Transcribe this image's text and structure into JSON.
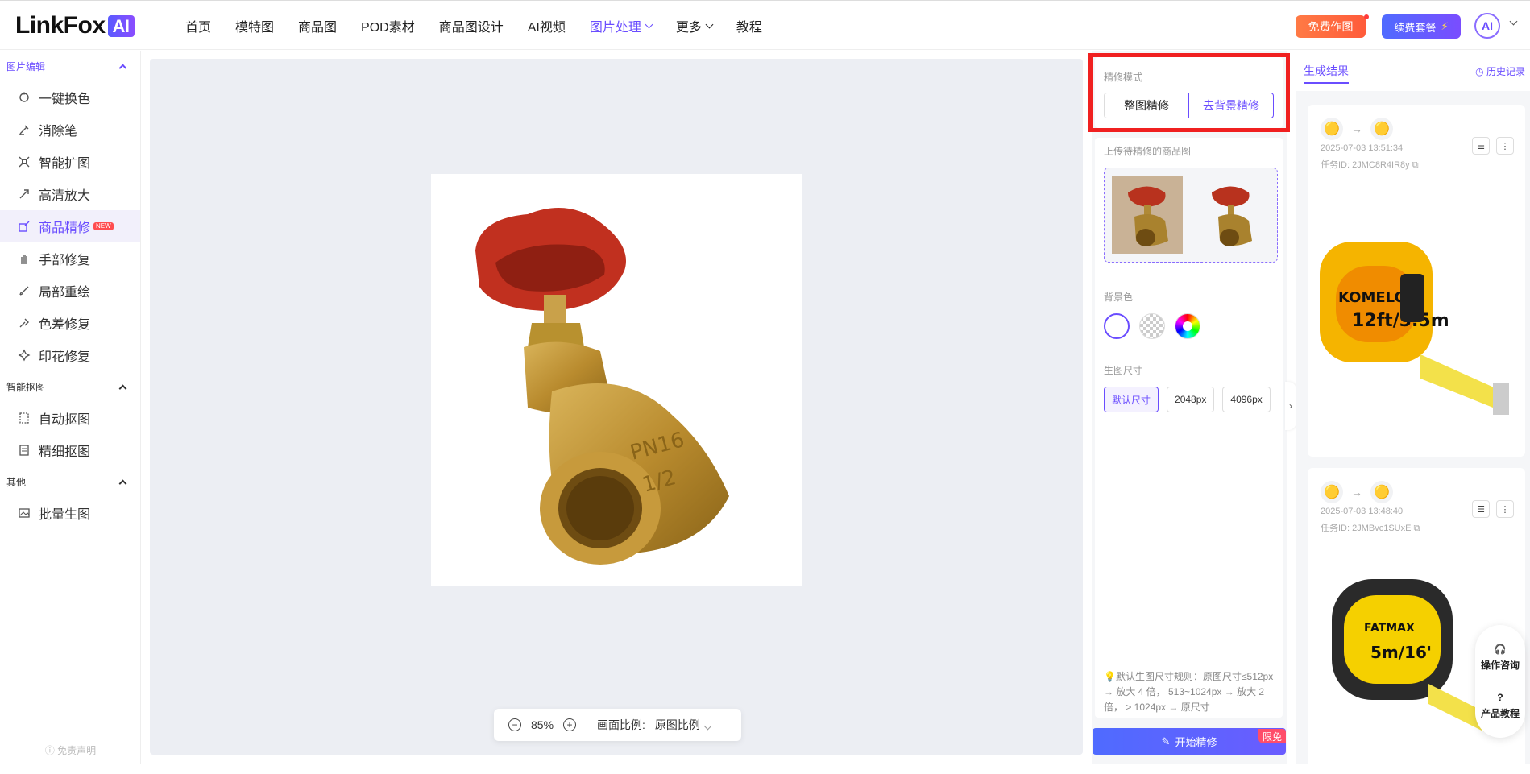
{
  "brand": {
    "name": "LinkFox",
    "ai": "AI"
  },
  "nav": [
    {
      "label": "首页"
    },
    {
      "label": "模特图"
    },
    {
      "label": "商品图"
    },
    {
      "label": "POD素材"
    },
    {
      "label": "商品图设计"
    },
    {
      "label": "AI视频"
    },
    {
      "label": "图片处理",
      "active": true
    },
    {
      "label": "更多"
    },
    {
      "label": "教程"
    }
  ],
  "header": {
    "free_label": "免费作图",
    "renew_label": "续费套餐",
    "renew_icon": "⚡",
    "avatar_text": "AI"
  },
  "sidebar": {
    "sections": [
      {
        "title": "图片编辑",
        "items": [
          {
            "label": "一键换色",
            "icon": "recolor-icon"
          },
          {
            "label": "消除笔",
            "icon": "eraser-icon"
          },
          {
            "label": "智能扩图",
            "icon": "expand-icon"
          },
          {
            "label": "高清放大",
            "icon": "upscale-icon"
          },
          {
            "label": "商品精修",
            "icon": "retouch-icon",
            "active": true,
            "badge": "NEW"
          },
          {
            "label": "手部修复",
            "icon": "hand-icon"
          },
          {
            "label": "局部重绘",
            "icon": "brush-icon"
          },
          {
            "label": "色差修复",
            "icon": "color-fix-icon"
          },
          {
            "label": "印花修复",
            "icon": "print-fix-icon"
          }
        ]
      },
      {
        "title": "智能抠图",
        "items": [
          {
            "label": "自动抠图",
            "icon": "auto-cutout-icon"
          },
          {
            "label": "精细抠图",
            "icon": "fine-cutout-icon"
          }
        ]
      },
      {
        "title": "其他",
        "items": [
          {
            "label": "批量生图",
            "icon": "batch-icon"
          }
        ]
      }
    ],
    "disclaimer": "免责声明"
  },
  "canvas": {
    "zoom": "85%",
    "ratio_label": "画面比例:",
    "ratio_value": "原图比例",
    "zoom_out": "−",
    "zoom_in": "+"
  },
  "controls": {
    "mode_label": "精修模式",
    "modes": [
      {
        "label": "整图精修"
      },
      {
        "label": "去背景精修",
        "active": true
      }
    ],
    "upload_label": "上传待精修的商品图",
    "bg_label": "背景色",
    "size_label": "生图尺寸",
    "sizes": [
      {
        "label": "默认尺寸",
        "active": true
      },
      {
        "label": "2048px"
      },
      {
        "label": "4096px"
      }
    ],
    "note": "💡默认生图尺寸规则：原图尺寸≤512px → 放大 4 倍， 513~1024px → 放大 2 倍， > 1024px → 原尺寸",
    "start_label": "开始精修",
    "limit_tag": "限免",
    "expand": "›"
  },
  "results": {
    "tab": "生成结果",
    "history": "历史记录",
    "items": [
      {
        "time": "2025-07-03 13:51:34",
        "task_id": "任务ID: 2JMC8R4IR8y"
      },
      {
        "time": "2025-07-03 13:48:40",
        "task_id": "任务ID: 2JMBvc1SUxE"
      }
    ]
  },
  "float_help": {
    "consult": "操作咨询",
    "tutorial": "产品教程"
  }
}
